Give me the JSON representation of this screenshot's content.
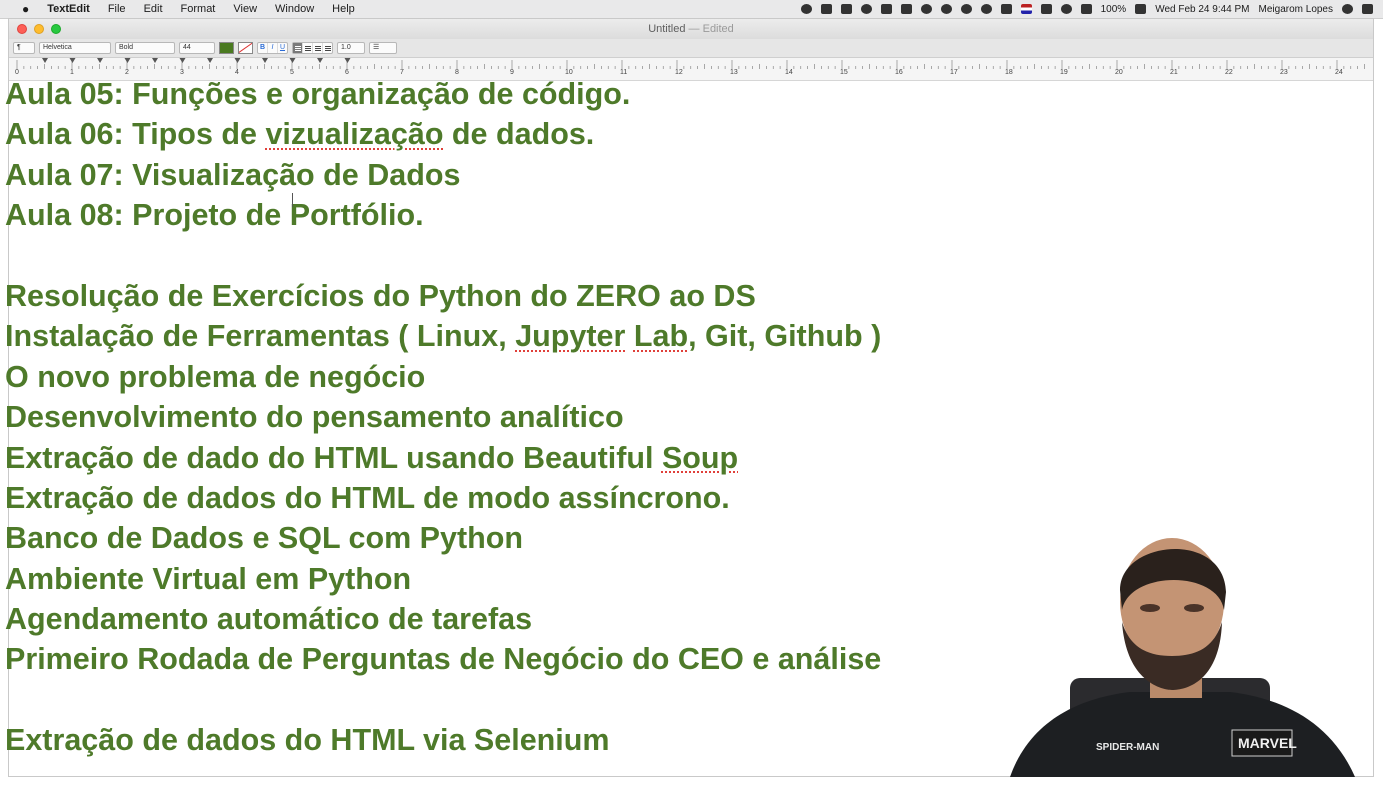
{
  "menubar": {
    "app_name": "TextEdit",
    "menus": [
      "File",
      "Edit",
      "Format",
      "View",
      "Window",
      "Help"
    ],
    "battery": "100%",
    "datetime": "Wed Feb 24  9:44 PM",
    "user": "Meigarom Lopes"
  },
  "window": {
    "title": "Untitled",
    "title_status": "— Edited"
  },
  "toolbar": {
    "paragraph_style": "¶",
    "font_family": "Helvetica",
    "font_style": "Bold",
    "font_size": "44",
    "bold_label": "B",
    "italic_label": "I",
    "underline_label": "U",
    "line_spacing": "1.0",
    "text_color": "#4a7a20"
  },
  "ruler": {
    "labels": [
      "0",
      "1",
      "2",
      "3",
      "4",
      "5",
      "6",
      "7",
      "8",
      "9",
      "10",
      "11",
      "12",
      "13",
      "14",
      "15",
      "16",
      "17",
      "18",
      "19",
      "20",
      "21",
      "22",
      "23",
      "24"
    ]
  },
  "document": {
    "text_color": "#4e7a2a",
    "group1": [
      "Aula 05: Funções e organização de código.",
      "Aula 06: Tipos de vizualização de dados.",
      "Aula 07: Visualização de Dados",
      "Aula 08: Projeto de Portfólio."
    ],
    "group2": [
      "Resolução de Exercícios do Python do ZERO ao DS",
      "Instalação de Ferramentas ( Linux, Jupyter Lab, Git, Github )",
      "O novo problema de negócio",
      "Desenvolvimento do pensamento analítico",
      "Extração de dado do HTML usando Beautiful Soup",
      "Extração de dados do HTML de modo assíncrono.",
      "Banco de Dados e SQL com Python",
      "Ambiente Virtual em Python",
      "Agendamento automático de tarefas",
      "Primeiro Rodada de Perguntas de Negócio do CEO e análise"
    ],
    "group3": [
      "Extração de dados do HTML via Selenium"
    ]
  },
  "presenter": {
    "shirt_brand": "MARVEL",
    "shirt_title": "SPIDER-MAN"
  }
}
